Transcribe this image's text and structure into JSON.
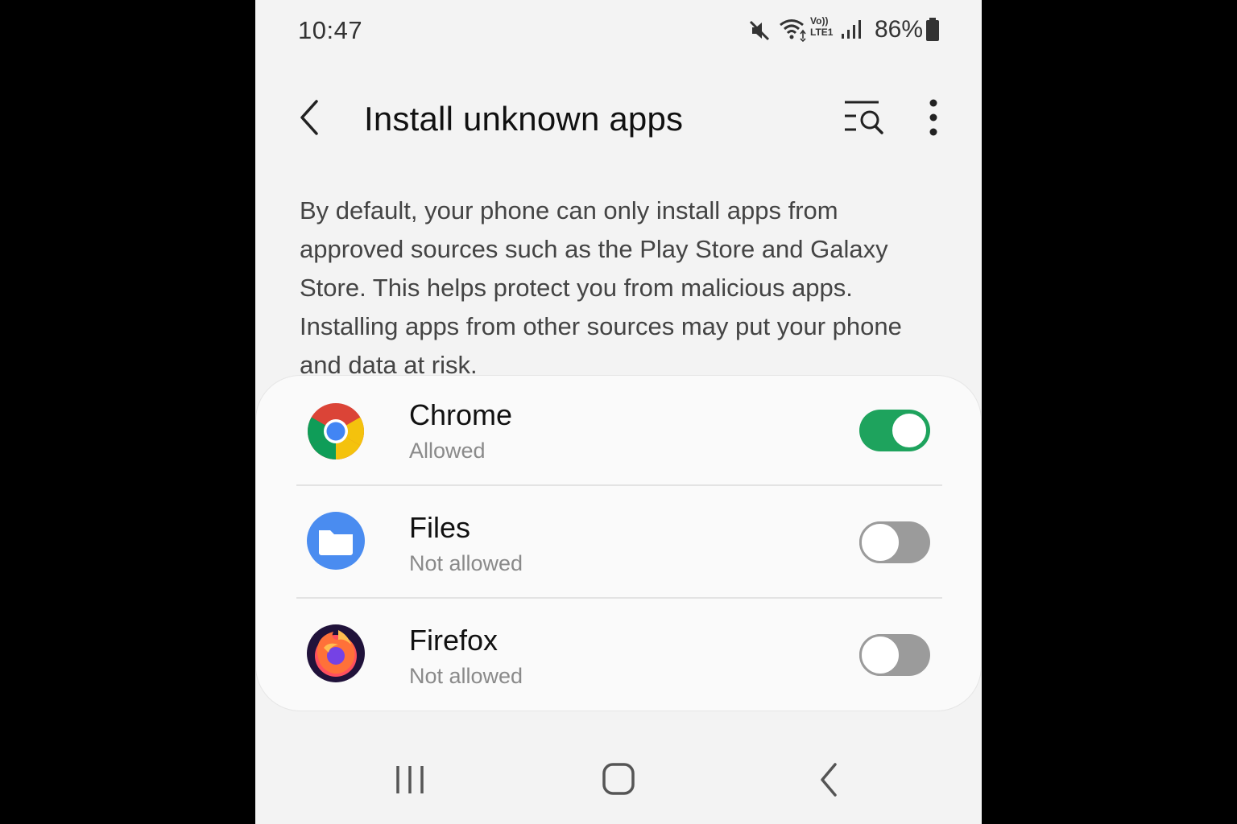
{
  "status_bar": {
    "time": "10:47",
    "battery_percent": "86%",
    "icons": [
      "mute-icon",
      "wifi-icon",
      "volte-lte-icon",
      "signal-icon",
      "battery-icon"
    ],
    "volte_label": "Vo))",
    "lte_label": "LTE1"
  },
  "header": {
    "title": "Install unknown apps",
    "back_icon": "back-arrow-icon",
    "search_icon": "search-list-icon",
    "more_icon": "more-vertical-icon"
  },
  "description": "By default, your phone can only install apps from approved sources such as the Play Store and Galaxy Store. This helps protect you from malicious apps. Installing apps from other sources may put your phone and data at risk.",
  "apps": [
    {
      "name": "Chrome",
      "status": "Allowed",
      "enabled": true,
      "icon": "chrome-icon"
    },
    {
      "name": "Files",
      "status": "Not allowed",
      "enabled": false,
      "icon": "files-icon"
    },
    {
      "name": "Firefox",
      "status": "Not allowed",
      "enabled": false,
      "icon": "firefox-icon"
    }
  ],
  "colors": {
    "toggle_on": "#1ea35d",
    "toggle_off": "#9b9b9b",
    "background": "#f3f3f3",
    "card": "#fafafa"
  },
  "nav_bar": {
    "icons": [
      "recents-icon",
      "home-icon",
      "back-icon"
    ]
  }
}
